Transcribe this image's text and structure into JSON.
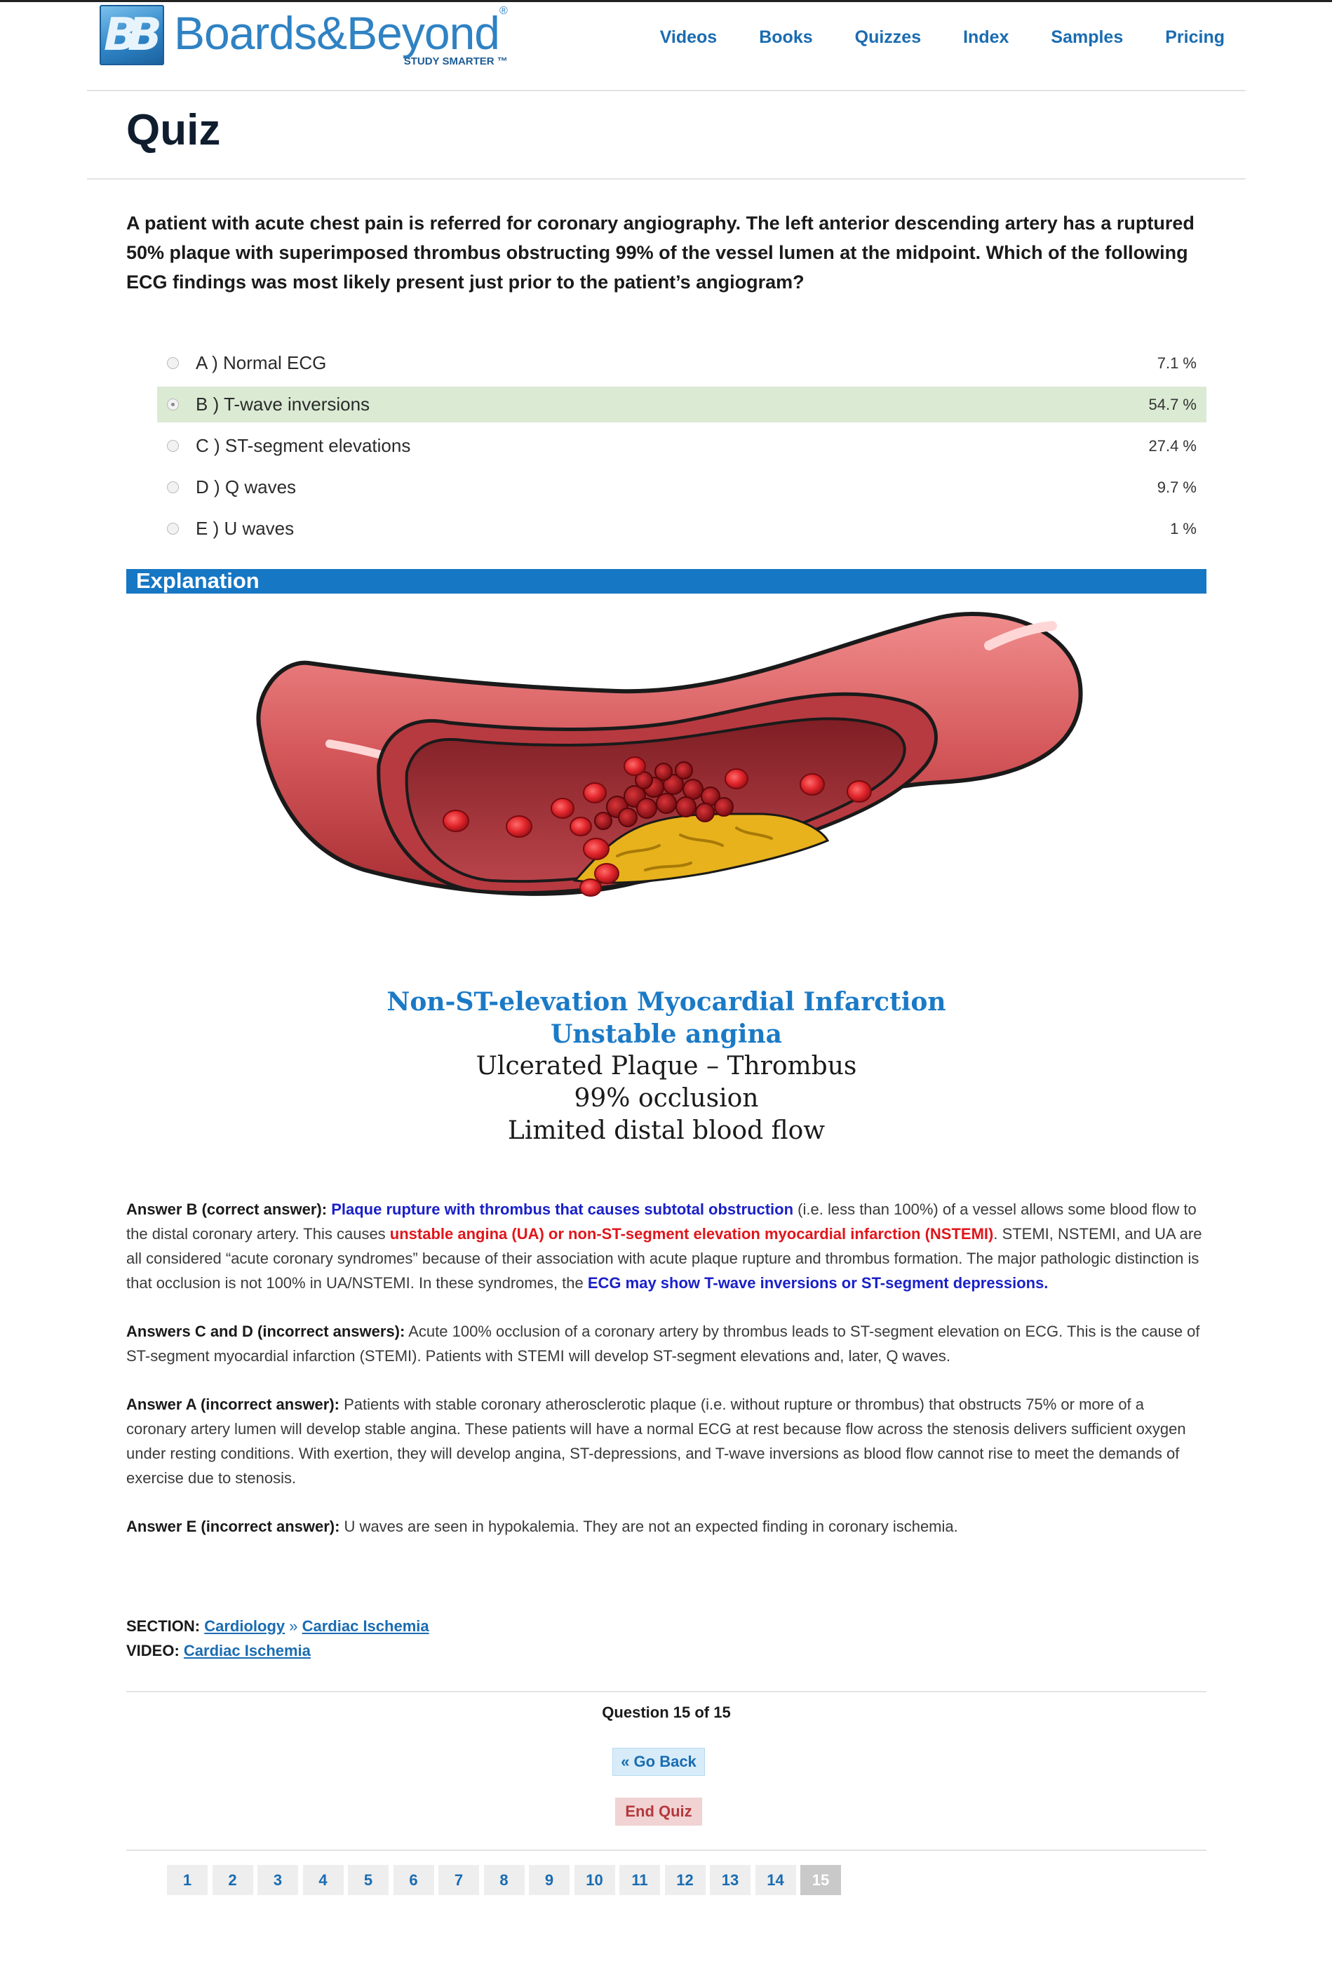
{
  "header": {
    "logo_mark": "BB",
    "logo_name": "Boards&Beyond",
    "logo_registered": "®",
    "logo_tagline": "STUDY SMARTER ™",
    "nav": [
      "Videos",
      "Books",
      "Quizzes",
      "Index",
      "Samples",
      "Pricing"
    ]
  },
  "page_title": "Quiz",
  "question": "A patient with acute chest pain is referred for coronary angiography. The left anterior descending artery has a ruptured 50% plaque with superimposed thrombus obstructing 99% of the vessel lumen at the midpoint. Which of the following ECG findings was most likely present just prior to the patient’s angiogram?",
  "answers": [
    {
      "label": "A ) Normal ECG",
      "percent": "7.1 %",
      "selected": false
    },
    {
      "label": "B ) T-wave inversions",
      "percent": "54.7 %",
      "selected": true
    },
    {
      "label": "C ) ST-segment elevations",
      "percent": "27.4 %",
      "selected": false
    },
    {
      "label": "D ) Q waves",
      "percent": "9.7 %",
      "selected": false
    },
    {
      "label": "E ) U waves",
      "percent": "1 %",
      "selected": false
    }
  ],
  "explanation_heading": "Explanation",
  "figure_caption": {
    "line1": "Non-ST-elevation Myocardial Infarction",
    "line2": "Unstable angina",
    "line3": "Ulcerated Plaque – Thrombus",
    "line4": "99% occlusion",
    "line5": "Limited distal blood flow"
  },
  "explanation": {
    "b_lead": "Answer B (correct answer):",
    "b_blue1": "Plaque rupture with thrombus that causes subtotal obstruction",
    "b_text1": " (i.e. less than 100%) of a vessel allows some blood flow to the distal coronary artery. This causes ",
    "b_red": "unstable angina (UA) or non-ST-segment elevation myocardial infarction (NSTEMI)",
    "b_text2": ". STEMI, NSTEMI, and UA are all considered “acute coronary syndromes” because of their association with acute plaque rupture and thrombus formation. The major pathologic distinction is that occlusion is not 100% in UA/NSTEMI. In these syndromes, the ",
    "b_blue2": "ECG may show T-wave inversions or ST-segment depressions.",
    "cd_lead": "Answers C and D (incorrect answers):",
    "cd_text": " Acute 100% occlusion of a coronary artery by thrombus leads to ST-segment elevation on ECG.  This is the cause of ST-segment myocardial infarction (STEMI). Patients with STEMI will develop ST-segment elevations and, later, Q waves.",
    "a_lead": "Answer A (incorrect answer):",
    "a_text": " Patients with stable coronary atherosclerotic plaque (i.e. without rupture or thrombus) that obstructs 75% or more of a coronary artery lumen will develop stable angina. These patients will have a normal ECG at rest because flow across the stenosis delivers sufficient oxygen under resting conditions. With exertion, they will develop angina, ST-depressions, and T-wave inversions as blood flow cannot rise to meet the demands of exercise due to stenosis.",
    "e_lead": "Answer E (incorrect answer):",
    "e_text": " U waves are seen in hypokalemia. They are not an expected finding in coronary ischemia."
  },
  "meta": {
    "section_label": "SECTION:",
    "section_link1": "Cardiology",
    "section_sep": " » ",
    "section_link2": "Cardiac Ischemia",
    "video_label": "VIDEO:",
    "video_link": "Cardiac Ischemia"
  },
  "navigation": {
    "question_count": "Question 15 of 15",
    "go_back": "« Go Back",
    "end_quiz": "End Quiz",
    "pages": [
      "1",
      "2",
      "3",
      "4",
      "5",
      "6",
      "7",
      "8",
      "9",
      "10",
      "11",
      "12",
      "13",
      "14",
      "15"
    ],
    "current_page": "15"
  },
  "colors": {
    "brand_blue": "#1677c4",
    "selected_answer_bg": "#dbead3",
    "emphasis_blue": "#1a20c8",
    "emphasis_red": "#e0161b",
    "plaque_yellow": "#e8b21c",
    "vessel_red": "#c94a4d"
  }
}
